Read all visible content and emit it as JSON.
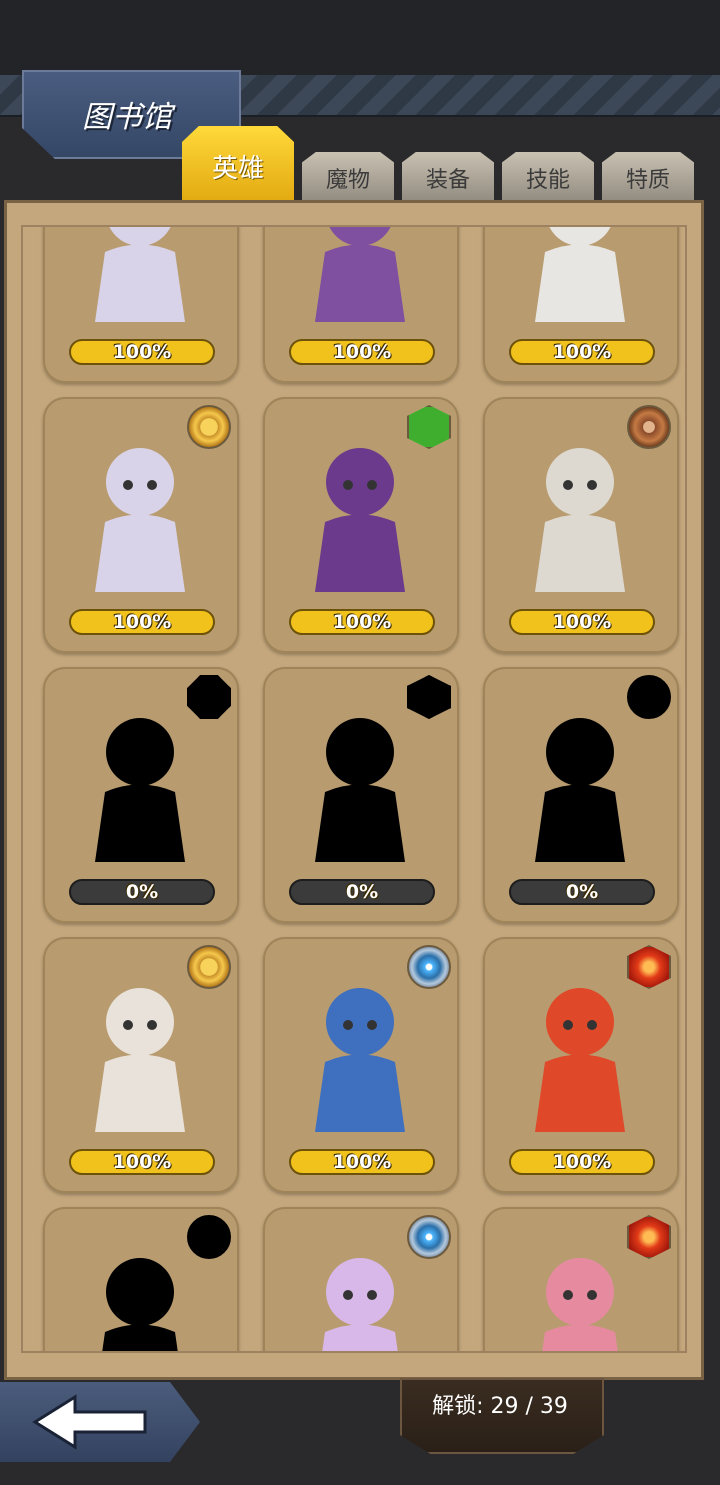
{
  "title": "图书馆",
  "tabs": [
    {
      "label": "英雄",
      "active": true
    },
    {
      "label": "魔物",
      "active": false
    },
    {
      "label": "装备",
      "active": false
    },
    {
      "label": "技能",
      "active": false
    },
    {
      "label": "特质",
      "active": false
    }
  ],
  "cards": [
    {
      "progress": "100%",
      "element": "none",
      "unlocked": true,
      "partial": true
    },
    {
      "progress": "100%",
      "element": "none",
      "unlocked": true,
      "partial": true
    },
    {
      "progress": "100%",
      "element": "none",
      "unlocked": true,
      "partial": true
    },
    {
      "progress": "100%",
      "element": "sun-icon",
      "unlocked": true
    },
    {
      "progress": "100%",
      "element": "leaf-icon",
      "unlocked": true
    },
    {
      "progress": "100%",
      "element": "dark-icon",
      "unlocked": true
    },
    {
      "progress": "0%",
      "element": "unknown-octagon-icon",
      "unlocked": false
    },
    {
      "progress": "0%",
      "element": "unknown-hexagon-icon",
      "unlocked": false
    },
    {
      "progress": "0%",
      "element": "unknown-circle-icon",
      "unlocked": false
    },
    {
      "progress": "100%",
      "element": "sun-icon",
      "unlocked": true
    },
    {
      "progress": "100%",
      "element": "ice-icon",
      "unlocked": true
    },
    {
      "progress": "100%",
      "element": "fire-icon",
      "unlocked": true
    },
    {
      "progress": "",
      "element": "unknown-circle-icon",
      "unlocked": false,
      "partial": true
    },
    {
      "progress": "",
      "element": "ice-icon",
      "unlocked": true,
      "partial": true
    },
    {
      "progress": "",
      "element": "fire-icon",
      "unlocked": true,
      "partial": true
    }
  ],
  "footer": {
    "unlock_text": "解锁: 29 / 39",
    "back_icon": "back-arrow-icon"
  }
}
